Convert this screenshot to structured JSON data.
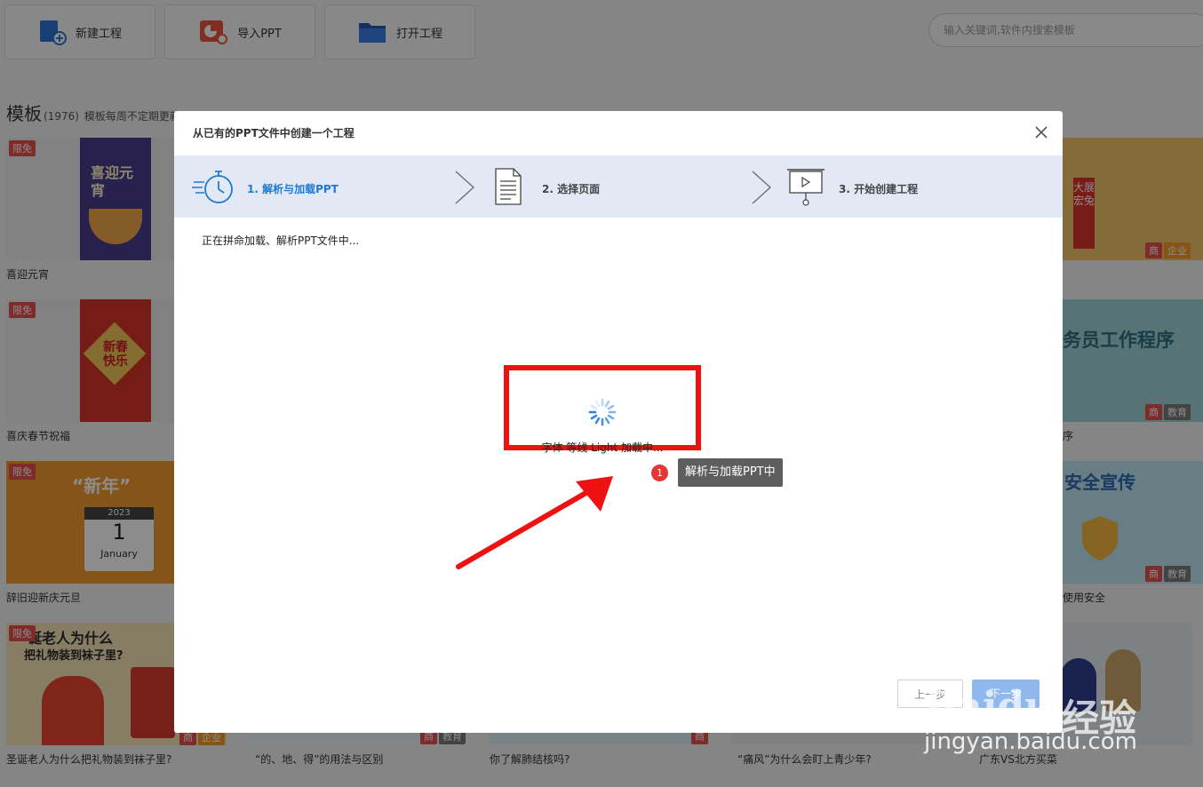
{
  "toolbar": {
    "new_project": "新建工程",
    "import_ppt": "导入PPT",
    "open_project": "打开工程",
    "search_placeholder": "输入关键词,软件内搜索模板"
  },
  "templates": {
    "title": "模板",
    "count": "(1976)",
    "desc": "模板每周不定期更新",
    "rows": [
      {
        "left_label": "喜迎元宵",
        "left_tag": "限免",
        "right_tags": [
          "商",
          "企业"
        ]
      },
      {
        "left_label": "喜庆春节祝福",
        "left_tag": "限免",
        "right_label": "务员工作程序",
        "right_label_tail": "序",
        "right_tags": [
          "商",
          "教育"
        ]
      },
      {
        "left_label": "辞旧迎新庆元旦",
        "left_tag": "限免",
        "right_label": "使用安全",
        "right_tags": [
          "商",
          "教育"
        ]
      },
      {
        "left_label": "圣诞老人为什么把礼物装到袜子里?",
        "left_tag": "限免",
        "left_tags": [
          "商",
          "企业"
        ]
      }
    ],
    "bottom_labels": [
      "“的、地、得”的用法与区别",
      "你了解肺结核吗?",
      "“痛风”为什么会盯上青少年?",
      "广东VS北方买菜"
    ],
    "bottom_tags": [
      "商",
      "教育",
      "商"
    ],
    "card_texts": {
      "yuanxiao": "喜迎元宵",
      "chunjie": "新春快乐",
      "xinnian": "“新年”",
      "year": "2023",
      "day": "1",
      "month": "January",
      "christmas_line1": "诞老人为什么",
      "christmas_line2": "把礼物装到袜子里?",
      "dazhan": "大展宏兔",
      "anquan": "安全宣传"
    }
  },
  "dialog": {
    "title": "从已有的PPT文件中创建一个工程",
    "steps": [
      {
        "label": "1. 解析与加载PPT",
        "active": true
      },
      {
        "label": "2. 选择页面",
        "active": false
      },
      {
        "label": "3. 开始创建工程",
        "active": false
      }
    ],
    "status": "正在拼命加载、解析PPT文件中...",
    "loading_text": "字体 等线 Light 加载中...",
    "tooltip_badge": "1",
    "tooltip_text": "解析与加载PPT中",
    "prev_button": "上一步",
    "next_button": "下一步"
  },
  "watermark": {
    "brand": "Baidu",
    "brand_cn": "经验",
    "url": "jingyan.baidu.com"
  },
  "colors": {
    "accent": "#1e7ad3",
    "highlight_box": "#ee1111",
    "steps_bg": "#e2e8f4",
    "tag_red": "#e5504c"
  }
}
